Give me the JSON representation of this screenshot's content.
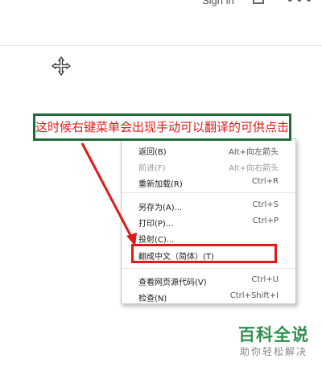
{
  "topbar": {
    "signin": "Sign in"
  },
  "annotation": {
    "text": "这时候右键菜单会出现手动可以翻译的可供点击"
  },
  "menu": {
    "items": [
      {
        "label": "返回(B)",
        "shortcut": "Alt+向左箭头"
      },
      {
        "label": "前进(F)",
        "shortcut": "Alt+向右箭头"
      },
      {
        "label": "重新加载(R)",
        "shortcut": "Ctrl+R"
      },
      {
        "label": "另存为(A)...",
        "shortcut": "Ctrl+S"
      },
      {
        "label": "打印(P)...",
        "shortcut": "Ctrl+P"
      },
      {
        "label": "投射(C)...",
        "shortcut": ""
      },
      {
        "label": "翻成中文（简体）(T)",
        "shortcut": ""
      },
      {
        "label": "查看网页源代码(V)",
        "shortcut": "Ctrl+U"
      },
      {
        "label": "检查(N)",
        "shortcut": "Ctrl+Shift+I"
      }
    ]
  },
  "logo": {
    "title": "百科全说",
    "subtitle": "助你轻松解决"
  },
  "colors": {
    "annotation_border": "#1f6b3a",
    "annotation_text": "#e01a1a",
    "logo_green": "#2f8f4e"
  }
}
